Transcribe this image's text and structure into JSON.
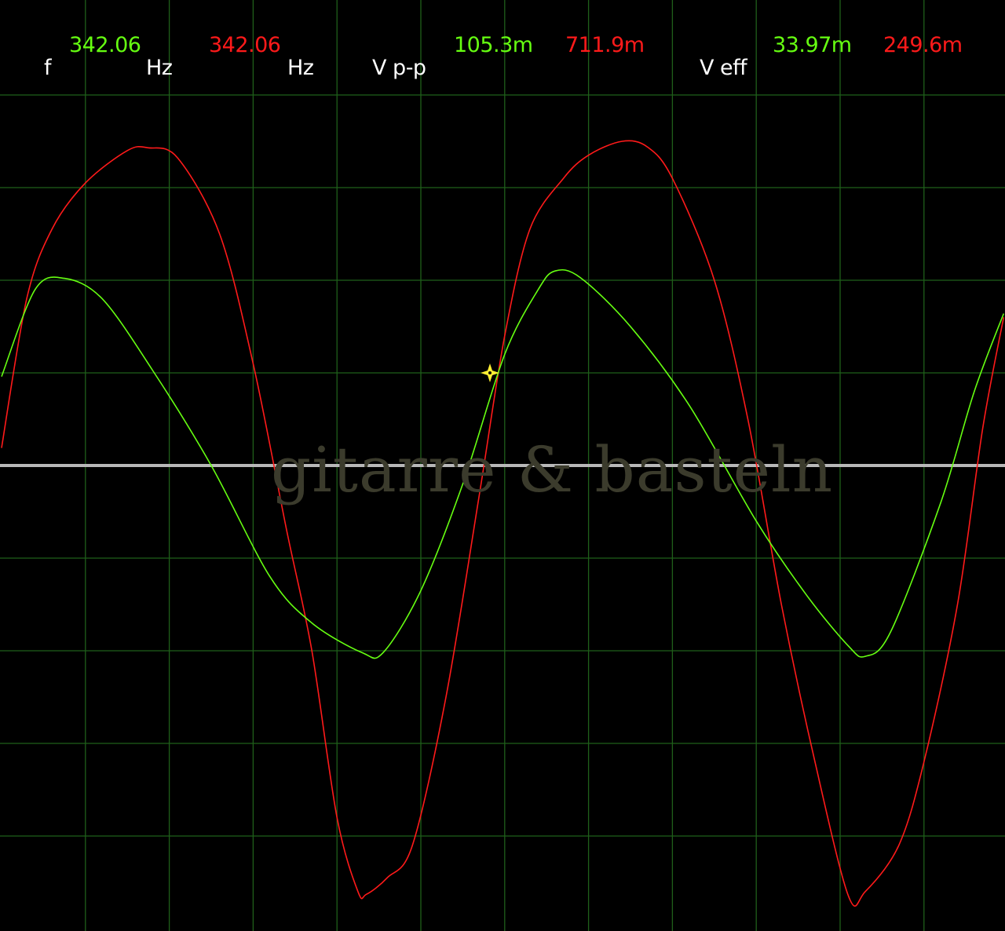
{
  "readouts": {
    "f_label": "f",
    "freq_ch1": "342.06",
    "freq_ch2": "342.06",
    "hz_unit_1": "Hz",
    "hz_unit_2": "Hz",
    "vpp_label": "V p-p",
    "vpp_ch1": "105.3m",
    "vpp_ch2": "711.9m",
    "veff_label": "V eff",
    "veff_ch1": "33.97m",
    "veff_ch2": "249.6m"
  },
  "watermark": "gitarre & basteln",
  "colors": {
    "background": "#000000",
    "grid": "#1f5f1a",
    "baseline": "#b8b8b8",
    "ch1": "#66ff11",
    "ch2": "#ff1a1a",
    "cursor": "#ffee33",
    "label": "#ffffff"
  },
  "icons": {
    "cursor": "trigger-cursor-icon"
  },
  "chart_data": {
    "type": "line",
    "title": "",
    "xlabel": "",
    "ylabel": "",
    "frequency_hz": 342.06,
    "series": [
      {
        "channel": "ch1",
        "color": "#66ff11",
        "vpp": "105.3m",
        "veff": "33.97m",
        "divisions": [
          [
            0,
            0.96
          ],
          [
            0.4,
            1.9
          ],
          [
            0.75,
            2.02
          ],
          [
            1.2,
            1.8
          ],
          [
            1.8,
            1.03
          ],
          [
            2.5,
            0
          ],
          [
            3.2,
            -1.2
          ],
          [
            3.7,
            -1.7
          ],
          [
            4.3,
            -2.02
          ],
          [
            4.55,
            -2.02
          ],
          [
            5.0,
            -1.35
          ],
          [
            5.5,
            -0.2
          ],
          [
            6.0,
            1.2
          ],
          [
            6.4,
            1.9
          ],
          [
            6.6,
            2.1
          ],
          [
            6.9,
            2.03
          ],
          [
            7.5,
            1.5
          ],
          [
            8.2,
            0.65
          ],
          [
            9.0,
            -0.6
          ],
          [
            9.6,
            -1.4
          ],
          [
            10.1,
            -1.95
          ],
          [
            10.3,
            -2.06
          ],
          [
            10.6,
            -1.8
          ],
          [
            11.2,
            -0.4
          ],
          [
            11.6,
            0.8
          ],
          [
            11.95,
            1.64
          ]
        ]
      },
      {
        "channel": "ch2",
        "color": "#ff1a1a",
        "vpp": "711.9m",
        "veff": "249.6m",
        "divisions": [
          [
            0,
            0.19
          ],
          [
            0.3,
            1.8
          ],
          [
            0.6,
            2.55
          ],
          [
            1.0,
            3.05
          ],
          [
            1.5,
            3.4
          ],
          [
            1.75,
            3.43
          ],
          [
            2.1,
            3.32
          ],
          [
            2.6,
            2.5
          ],
          [
            3.0,
            1.1
          ],
          [
            3.4,
            -0.7
          ],
          [
            3.7,
            -2.0
          ],
          [
            4.0,
            -3.8
          ],
          [
            4.25,
            -4.6
          ],
          [
            4.35,
            -4.63
          ],
          [
            4.6,
            -4.45
          ],
          [
            4.9,
            -4.1
          ],
          [
            5.3,
            -2.5
          ],
          [
            5.7,
            -0.3
          ],
          [
            6.0,
            1.4
          ],
          [
            6.3,
            2.55
          ],
          [
            6.7,
            3.1
          ],
          [
            7.0,
            3.35
          ],
          [
            7.4,
            3.5
          ],
          [
            7.7,
            3.44
          ],
          [
            8.0,
            3.1
          ],
          [
            8.5,
            2.0
          ],
          [
            8.9,
            0.5
          ],
          [
            9.3,
            -1.5
          ],
          [
            9.7,
            -3.2
          ],
          [
            10.1,
            -4.65
          ],
          [
            10.3,
            -4.6
          ],
          [
            10.7,
            -4.1
          ],
          [
            11.0,
            -3.2
          ],
          [
            11.4,
            -1.5
          ],
          [
            11.7,
            0.4
          ],
          [
            11.95,
            1.6
          ]
        ]
      }
    ]
  }
}
